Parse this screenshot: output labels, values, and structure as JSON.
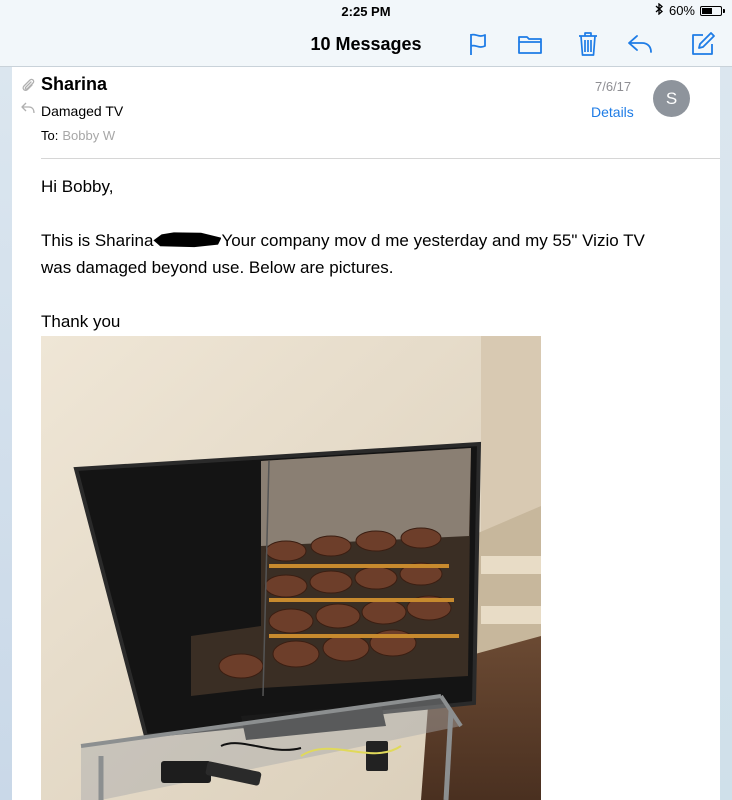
{
  "status_bar": {
    "time": "2:25 PM",
    "battery_text": "60%",
    "battery_level": 0.6
  },
  "nav": {
    "title": "10 Messages",
    "icons": [
      "flag-icon",
      "folder-icon",
      "trash-icon",
      "reply-icon",
      "compose-icon"
    ]
  },
  "message": {
    "sender": "Sharina",
    "subject": "Damaged TV",
    "to_label": "To:",
    "to_value": "Bobby W",
    "date": "7/6/17",
    "details_label": "Details",
    "avatar_initial": "S",
    "greeting": "Hi Bobby,",
    "body_part1": "This is Sharina",
    "body_part2": "Your company mov d me yesterday and my 55\" Vizio TV",
    "body_line2": "was damaged beyond use. Below are pictures.",
    "signoff": "Thank you"
  },
  "colors": {
    "accent": "#1e7ce6",
    "secondary_text": "#8e8e93"
  }
}
